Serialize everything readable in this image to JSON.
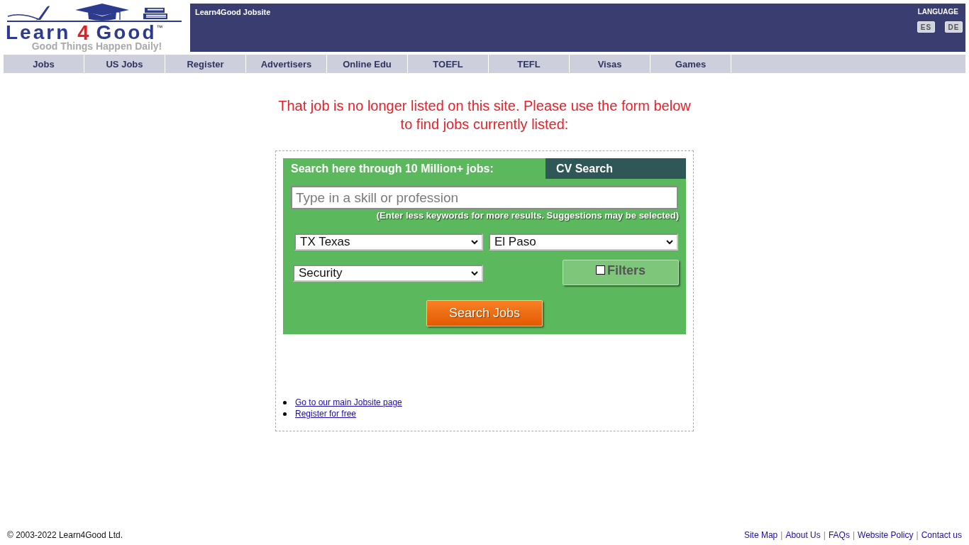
{
  "header": {
    "logo": {
      "word_1": "Learn",
      "word_2": "4",
      "word_3": "Good",
      "trademark": "™",
      "tagline": "Good Things Happen Daily!"
    },
    "site_title": "Learn4Good Jobsite",
    "language": {
      "label": "LANGUAGE",
      "buttons": [
        "ES",
        "DE"
      ]
    }
  },
  "nav": [
    "Jobs",
    "US Jobs",
    "Register",
    "Advertisers",
    "Online Edu",
    "TOEFL",
    "TEFL",
    "Visas",
    "Games"
  ],
  "message": "That job is no longer listed on this site. Please use the form below to find jobs currently listed:",
  "search": {
    "heading": "Search here through 10 Million+ jobs:",
    "cv_search": "CV Search",
    "keyword": {
      "placeholder": "Type in a skill or profession"
    },
    "hint": "(Enter less keywords for more results. Suggestions may be selected)",
    "state": "TX Texas",
    "city": "El Paso",
    "category": "Security",
    "filters": {
      "label": "Filters",
      "checked": false
    },
    "submit": "Search Jobs"
  },
  "links": [
    "Go to our main Jobsite page",
    "Register for free"
  ],
  "footer": {
    "copyright": "© 2003-2022 Learn4Good Ltd.",
    "links": [
      "Site Map",
      "About Us",
      "FAQs",
      "Website Policy",
      "Contact us"
    ],
    "separators": [
      "|",
      "|",
      "|",
      "|"
    ]
  }
}
